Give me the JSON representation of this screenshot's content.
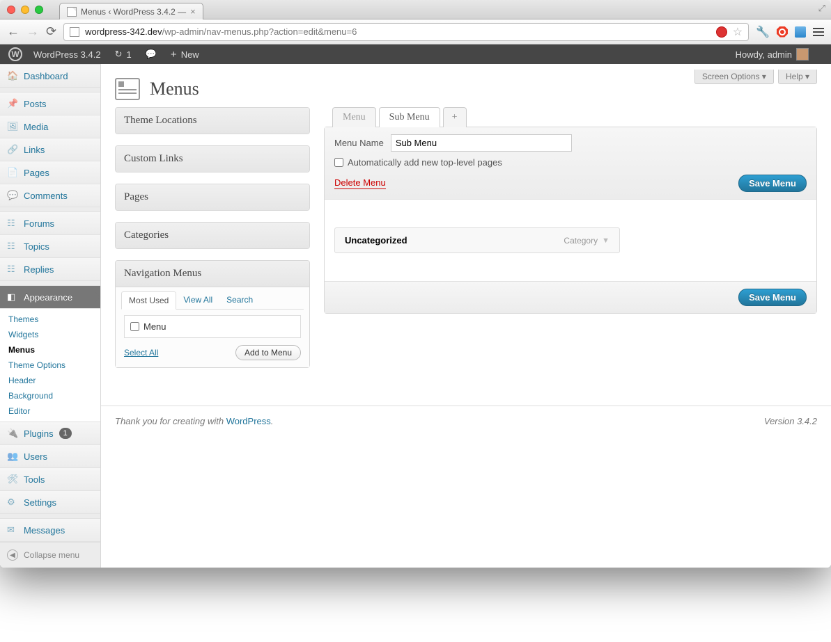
{
  "browser": {
    "tab_title": "Menus ‹ WordPress 3.4.2 —",
    "url_host": "wordpress-342.dev",
    "url_path": "/wp-admin/nav-menus.php?action=edit&menu=6"
  },
  "adminbar": {
    "site_name": "WordPress 3.4.2",
    "updates": "1",
    "new": "New",
    "howdy": "Howdy, admin"
  },
  "sidebar": {
    "dashboard": "Dashboard",
    "posts": "Posts",
    "media": "Media",
    "links": "Links",
    "pages": "Pages",
    "comments": "Comments",
    "forums": "Forums",
    "topics": "Topics",
    "replies": "Replies",
    "appearance": "Appearance",
    "appearance_sub": {
      "themes": "Themes",
      "widgets": "Widgets",
      "menus": "Menus",
      "theme_options": "Theme Options",
      "header": "Header",
      "background": "Background",
      "editor": "Editor"
    },
    "plugins": "Plugins",
    "plugins_count": "1",
    "users": "Users",
    "tools": "Tools",
    "settings": "Settings",
    "messages": "Messages",
    "collapse": "Collapse menu"
  },
  "screen_meta": {
    "screen_options": "Screen Options",
    "help": "Help"
  },
  "page": {
    "title": "Menus"
  },
  "boxes": {
    "theme_locations": "Theme Locations",
    "custom_links": "Custom Links",
    "pages": "Pages",
    "categories": "Categories",
    "nav_menus_title": "Navigation Menus",
    "nav_tabs": {
      "most_used": "Most Used",
      "view_all": "View All",
      "search": "Search"
    },
    "nav_item_menu": "Menu",
    "select_all": "Select All",
    "add_to_menu": "Add to Menu"
  },
  "menu_tabs": {
    "menu": "Menu",
    "sub_menu": "Sub Menu",
    "add": "+"
  },
  "editor": {
    "menu_name_label": "Menu Name",
    "menu_name_value": "Sub Menu",
    "auto_add_label": "Automatically add new top-level pages",
    "delete": "Delete Menu",
    "save": "Save Menu",
    "item": {
      "title": "Uncategorized",
      "type": "Category"
    }
  },
  "footer": {
    "thanks_pre": "Thank you for creating with ",
    "wp": "WordPress",
    "version": "Version 3.4.2"
  }
}
